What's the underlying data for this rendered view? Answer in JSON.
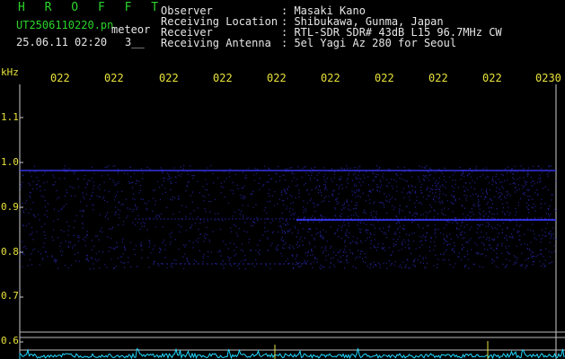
{
  "header": {
    "app_title": "H R O F F T",
    "filename": "UT2506110220.pn",
    "mode": "meteor",
    "datetime": "25.06.11 02:20",
    "count": "3__",
    "fields": [
      {
        "label": "Observer",
        "value": ": Masaki Kano"
      },
      {
        "label": "Receiving Location",
        "value": ": Shibukawa, Gunma, Japan"
      },
      {
        "label": "Receiver",
        "value": ": RTL-SDR SDR# 43dB L15 96.7MHz CW"
      },
      {
        "label": "Receiving Antenna",
        "value": ": 5el Yagi Az 280 for Seoul"
      }
    ]
  },
  "axis": {
    "y_unit": "kHz",
    "y_ticks": [
      "1.1",
      "1.0",
      "0.9",
      "0.8",
      "0.7",
      "0.6"
    ],
    "x_ticks": [
      "022",
      "022",
      "022",
      "022",
      "022",
      "022",
      "022",
      "022",
      "022",
      "0230"
    ]
  },
  "colors": {
    "background": "#000000",
    "axis_text": "#e8e23a",
    "title": "#2bd42b",
    "signal": "#3a3aff",
    "level": "#20d8ff"
  }
}
